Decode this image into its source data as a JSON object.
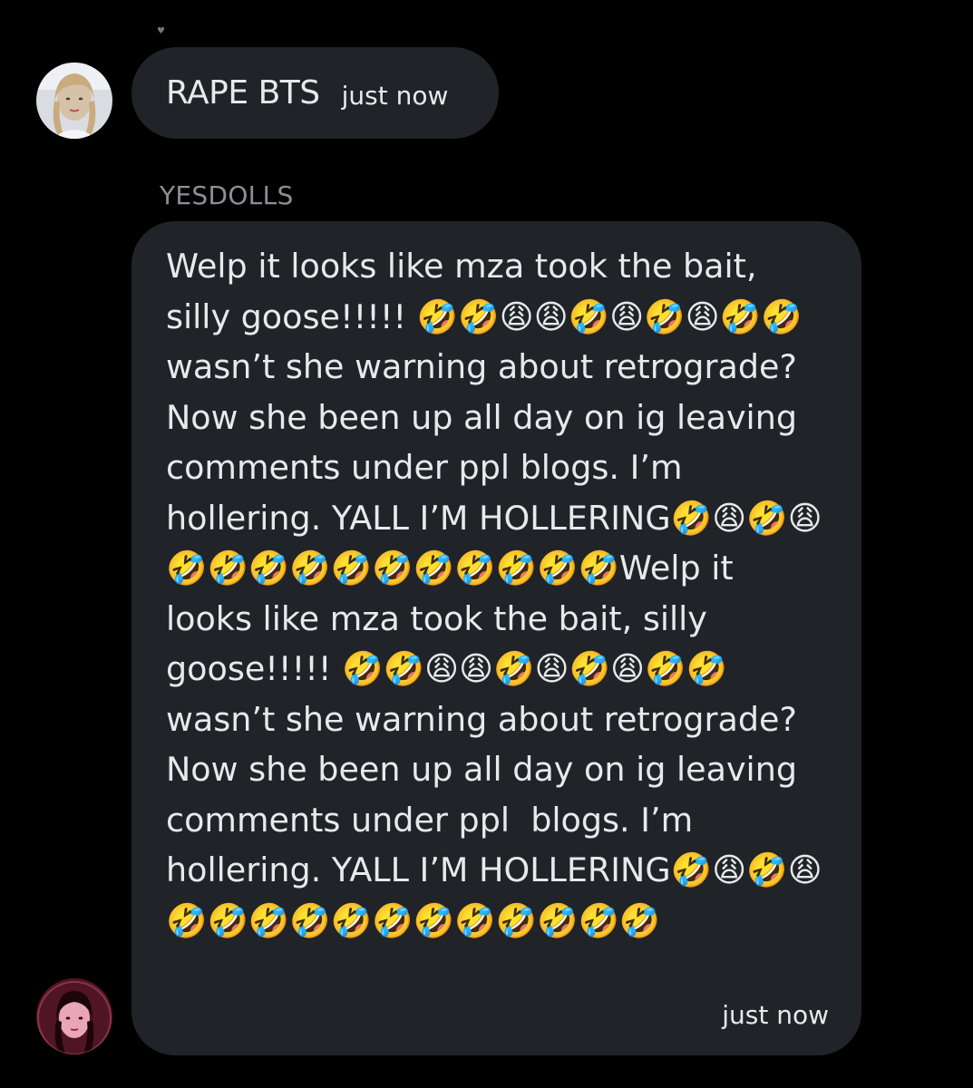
{
  "conversation": {
    "reaction_glyph": "♥",
    "messages": [
      {
        "author": "",
        "text": "RAPE BTS",
        "time": "just now",
        "avatar_icon": "user-avatar-icon"
      },
      {
        "author": "YESDOLLS",
        "text": "Welp it looks like mza took the bait, silly goose!!!!! 🤣🤣😩😩🤣😩🤣😩🤣🤣 wasn’t she warning about retrograde? Now she been up all day on ig leaving comments under ppl blogs. I’m hollering. YALL I’M HOLLERING🤣😩🤣😩🤣🤣🤣🤣🤣🤣🤣🤣🤣🤣🤣Welp it looks like mza took the bait, silly goose!!!!! 🤣🤣😩😩🤣😩🤣😩🤣🤣 wasn’t she warning about retrograde? Now she been up all day on ig leaving comments under ppl  blogs. I’m hollering. YALL I’M HOLLERING🤣😩🤣😩🤣🤣🤣🤣🤣🤣🤣🤣🤣🤣🤣🤣",
        "time": "just now",
        "avatar_icon": "user-avatar-icon"
      }
    ]
  },
  "colors": {
    "background": "#000000",
    "bubble": "#202327",
    "text": "#e7e9ea",
    "secondary_text": "#8b9096"
  }
}
